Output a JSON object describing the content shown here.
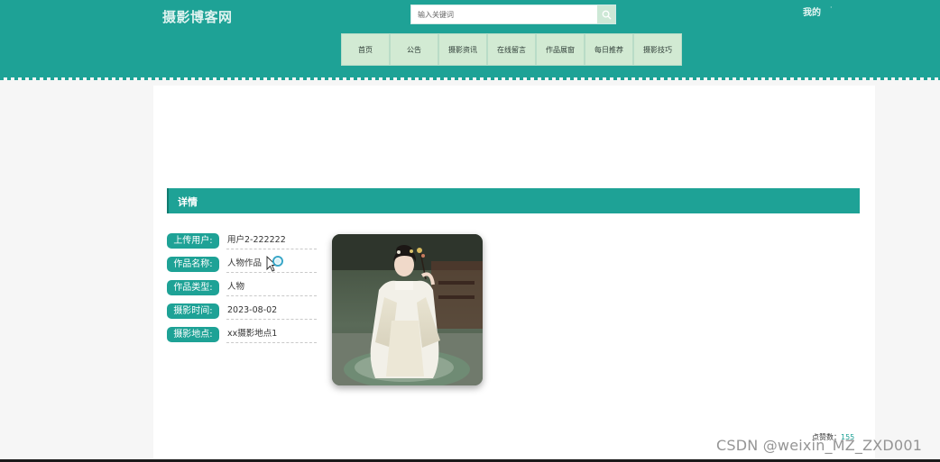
{
  "header": {
    "site_title": "摄影博客网",
    "search": {
      "placeholder": "输入关键词",
      "value": ""
    },
    "user_menu": "我的"
  },
  "nav": {
    "items": [
      "首页",
      "公告",
      "摄影资讯",
      "在线留言",
      "作品展窗",
      "每日推荐",
      "摄影技巧"
    ]
  },
  "detail": {
    "section_title": "详情",
    "fields": [
      {
        "label": "上传用户:",
        "value": "用户2-222222"
      },
      {
        "label": "作品名称:",
        "value": "人物作品"
      },
      {
        "label": "作品类型:",
        "value": "人物"
      },
      {
        "label": "摄影时间:",
        "value": "2023-08-02"
      },
      {
        "label": "摄影地点:",
        "value": "xx摄影地点1"
      }
    ],
    "likes_label": "点赞数：",
    "likes_value": "155"
  },
  "watermark": "CSDN @weixin_MZ_ZXD001",
  "colors": {
    "primary": "#1ea296",
    "nav_bg": "#d2ead3",
    "page_bg": "#f6f6f6"
  },
  "icons": [
    "search-icon",
    "dropdown-icon",
    "magnifier-cursor-icon",
    "photo-image"
  ]
}
